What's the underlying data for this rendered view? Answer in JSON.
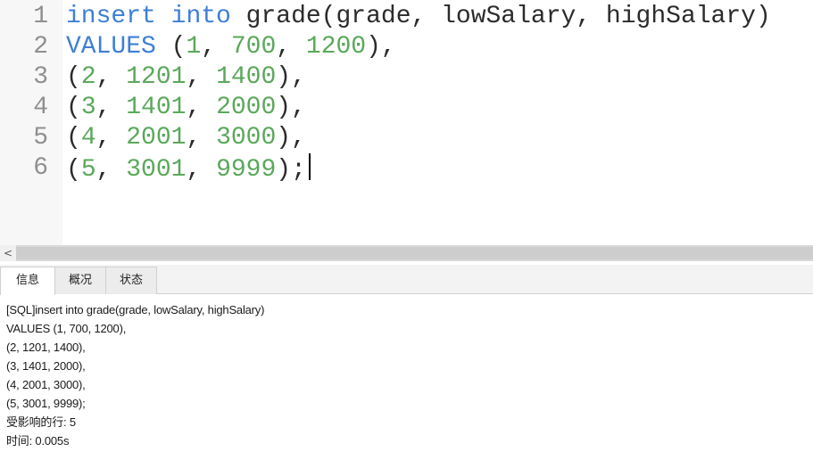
{
  "editor": {
    "lines": [
      {
        "num": "1",
        "tokens": [
          {
            "t": "insert",
            "c": "kw"
          },
          {
            "t": " ",
            "c": "pn"
          },
          {
            "t": "into",
            "c": "kw"
          },
          {
            "t": " grade(grade, lowSalary, highSalary)",
            "c": "id"
          }
        ]
      },
      {
        "num": "2",
        "tokens": [
          {
            "t": "VALUES",
            "c": "kw"
          },
          {
            "t": " (",
            "c": "pn"
          },
          {
            "t": "1",
            "c": "num"
          },
          {
            "t": ", ",
            "c": "pn"
          },
          {
            "t": "700",
            "c": "num"
          },
          {
            "t": ", ",
            "c": "pn"
          },
          {
            "t": "1200",
            "c": "num"
          },
          {
            "t": "),",
            "c": "pn"
          }
        ]
      },
      {
        "num": "3",
        "tokens": [
          {
            "t": "(",
            "c": "pn"
          },
          {
            "t": "2",
            "c": "num"
          },
          {
            "t": ", ",
            "c": "pn"
          },
          {
            "t": "1201",
            "c": "num"
          },
          {
            "t": ", ",
            "c": "pn"
          },
          {
            "t": "1400",
            "c": "num"
          },
          {
            "t": "),",
            "c": "pn"
          }
        ]
      },
      {
        "num": "4",
        "tokens": [
          {
            "t": "(",
            "c": "pn"
          },
          {
            "t": "3",
            "c": "num"
          },
          {
            "t": ", ",
            "c": "pn"
          },
          {
            "t": "1401",
            "c": "num"
          },
          {
            "t": ", ",
            "c": "pn"
          },
          {
            "t": "2000",
            "c": "num"
          },
          {
            "t": "),",
            "c": "pn"
          }
        ]
      },
      {
        "num": "5",
        "tokens": [
          {
            "t": "(",
            "c": "pn"
          },
          {
            "t": "4",
            "c": "num"
          },
          {
            "t": ", ",
            "c": "pn"
          },
          {
            "t": "2001",
            "c": "num"
          },
          {
            "t": ", ",
            "c": "pn"
          },
          {
            "t": "3000",
            "c": "num"
          },
          {
            "t": "),",
            "c": "pn"
          }
        ]
      },
      {
        "num": "6",
        "tokens": [
          {
            "t": "(",
            "c": "pn"
          },
          {
            "t": "5",
            "c": "num"
          },
          {
            "t": ", ",
            "c": "pn"
          },
          {
            "t": "3001",
            "c": "num"
          },
          {
            "t": ", ",
            "c": "pn"
          },
          {
            "t": "9999",
            "c": "num"
          },
          {
            "t": ");",
            "c": "pn"
          }
        ]
      }
    ],
    "colors": {
      "keyword": "#3d7fd6",
      "number": "#5aa85a",
      "identifier": "#2b2b2b",
      "line_number": "#8f8f8f"
    }
  },
  "scrollbar": {
    "left_arrow": "<"
  },
  "tabs": [
    {
      "label": "信息",
      "active": true
    },
    {
      "label": "概况",
      "active": false
    },
    {
      "label": "状态",
      "active": false
    }
  ],
  "output": {
    "lines": [
      "[SQL]insert into grade(grade, lowSalary, highSalary)",
      "VALUES (1, 700, 1200),",
      "(2, 1201, 1400),",
      "(3, 1401, 2000),",
      "(4, 2001, 3000),",
      "(5, 3001, 9999);",
      "受影响的行: 5",
      "时间: 0.005s"
    ]
  }
}
